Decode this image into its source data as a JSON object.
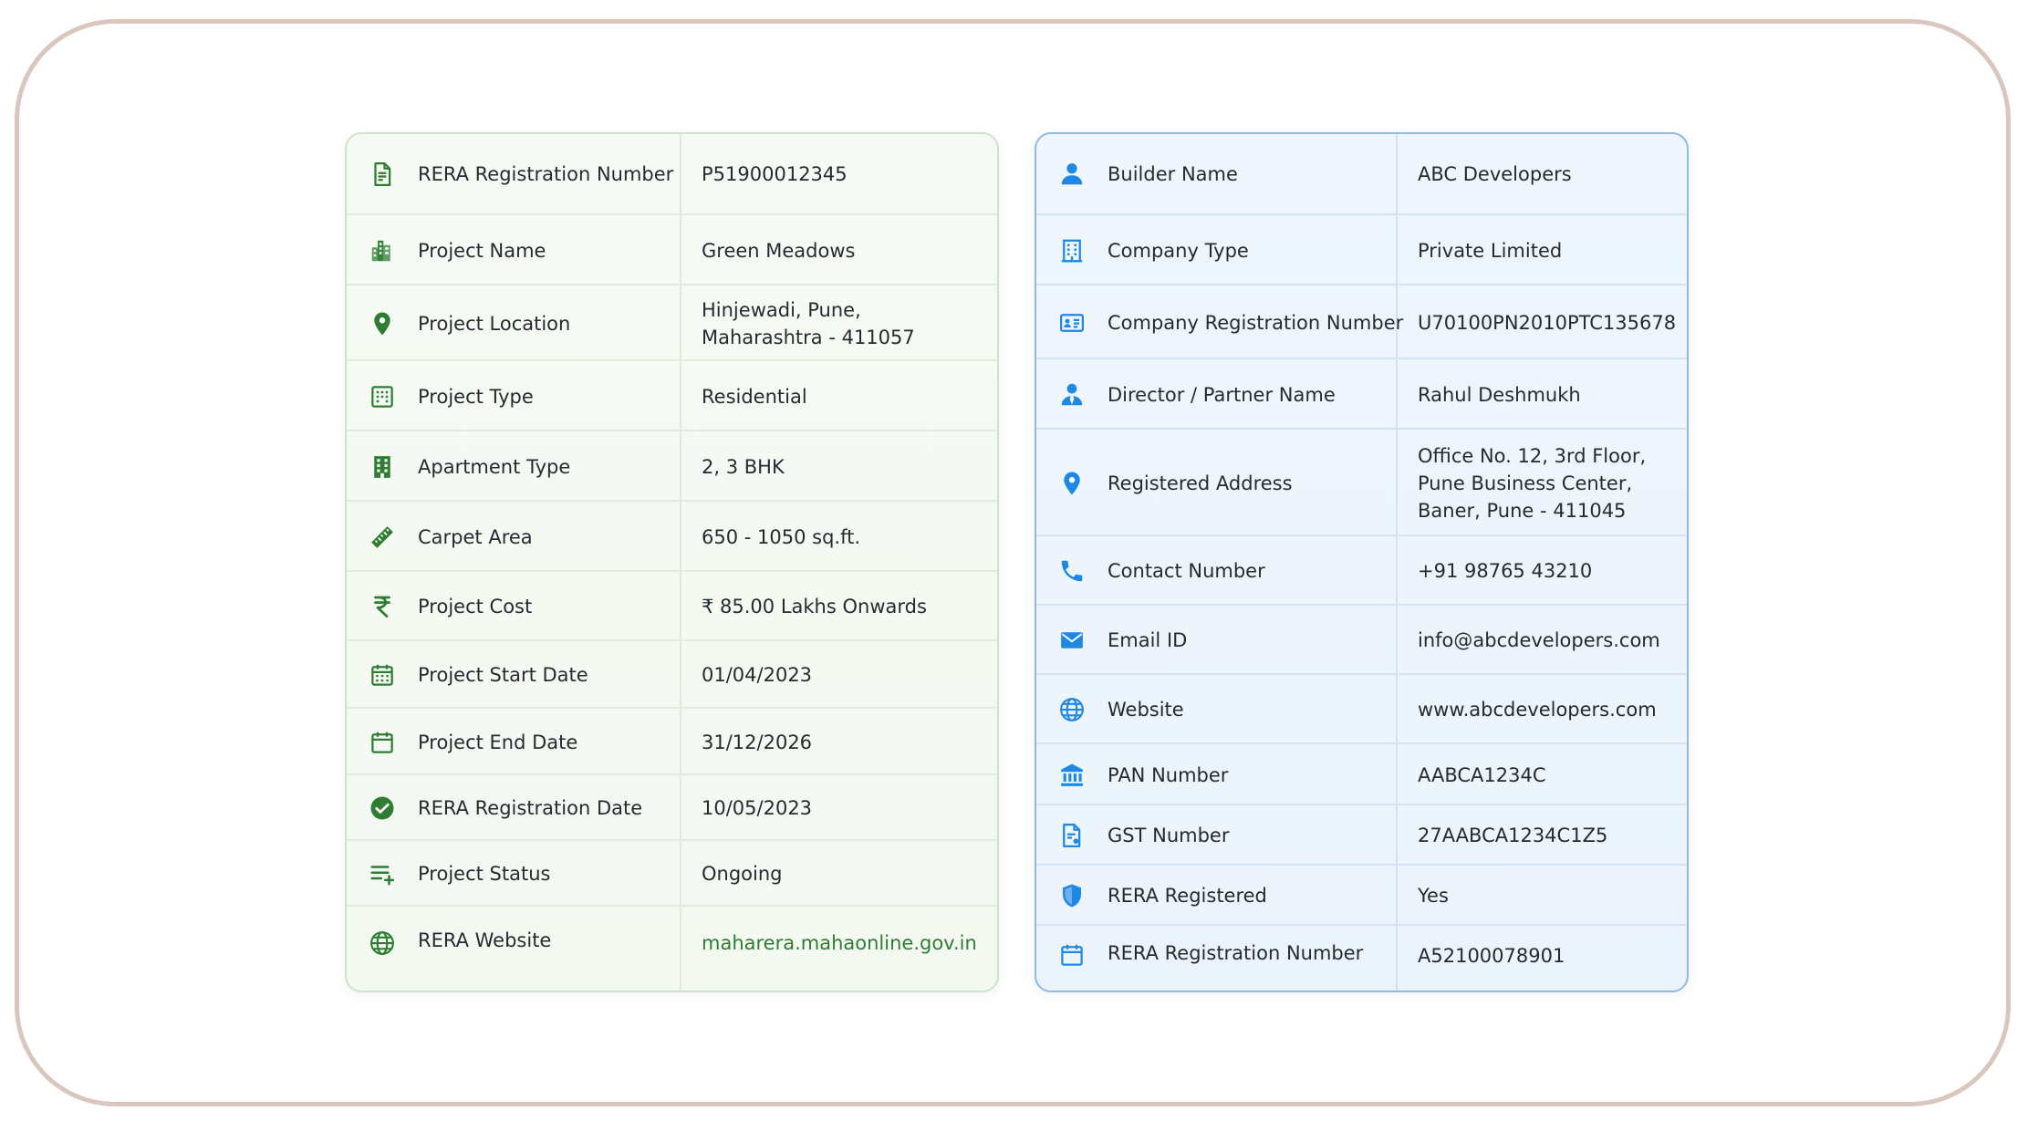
{
  "colors": {
    "green_accent": "#2e7d32",
    "blue_accent": "#1e88e5",
    "frame_border": "#d9c7bd"
  },
  "project_card": {
    "rows": [
      {
        "icon": "document-icon",
        "label": "RERA Registration Number",
        "value": "P51900012345"
      },
      {
        "icon": "buildings-icon",
        "label": "Project Name",
        "value": "Green Meadows"
      },
      {
        "icon": "location-pin-icon",
        "label": "Project Location",
        "value_line1": "Hinjewadi, Pune,",
        "value_line2": "Maharashtra - 411057"
      },
      {
        "icon": "building-grid-icon",
        "label": "Project Type",
        "value": "Residential"
      },
      {
        "icon": "apartment-icon",
        "label": "Apartment Type",
        "value": "2, 3 BHK"
      },
      {
        "icon": "ruler-icon",
        "label": "Carpet Area",
        "value": "650 - 1050 sq.ft."
      },
      {
        "icon": "rupee-icon",
        "label": "Project Cost",
        "value": "₹ 85.00 Lakhs Onwards"
      },
      {
        "icon": "calendar-grid-icon",
        "label": "Project Start Date",
        "value": "01/04/2023"
      },
      {
        "icon": "calendar-icon",
        "label": "Project End Date",
        "value": "31/12/2026"
      },
      {
        "icon": "check-circle-icon",
        "label": "RERA Registration Date",
        "value": "10/05/2023"
      },
      {
        "icon": "list-add-icon",
        "label": "Project Status",
        "value": "Ongoing"
      },
      {
        "icon": "globe-icon",
        "label": "RERA Website",
        "value": "maharera.mahaonline.gov.in"
      }
    ]
  },
  "builder_card": {
    "rows": [
      {
        "icon": "person-icon",
        "label": "Builder Name",
        "value": "ABC Developers"
      },
      {
        "icon": "office-building-icon",
        "label": "Company Type",
        "value": "Private Limited"
      },
      {
        "icon": "id-card-icon",
        "label": "Company Registration Number",
        "value": "U70100PN2010PTC135678"
      },
      {
        "icon": "person-tie-icon",
        "label": "Director / Partner Name",
        "value": "Rahul Deshmukh"
      },
      {
        "icon": "location-pin-icon",
        "label": "Registered Address",
        "value_line1": "Office No. 12, 3rd Floor,",
        "value_line2": "Pune Business Center,",
        "value_line3": "Baner, Pune - 411045"
      },
      {
        "icon": "phone-icon",
        "label": "Contact Number",
        "value": "+91 98765 43210"
      },
      {
        "icon": "mail-icon",
        "label": "Email ID",
        "value": "info@abcdevelopers.com"
      },
      {
        "icon": "globe-icon",
        "label": "Website",
        "value": "www.abcdevelopers.com"
      },
      {
        "icon": "bank-icon",
        "label": "PAN Number",
        "value": "AABCA1234C"
      },
      {
        "icon": "invoice-icon",
        "label": "GST Number",
        "value": "27AABCA1234C1Z5"
      },
      {
        "icon": "shield-icon",
        "label": "RERA Registered",
        "value": "Yes"
      },
      {
        "icon": "calendar-icon",
        "label": "RERA Registration Number",
        "value": "A52100078901"
      }
    ]
  }
}
